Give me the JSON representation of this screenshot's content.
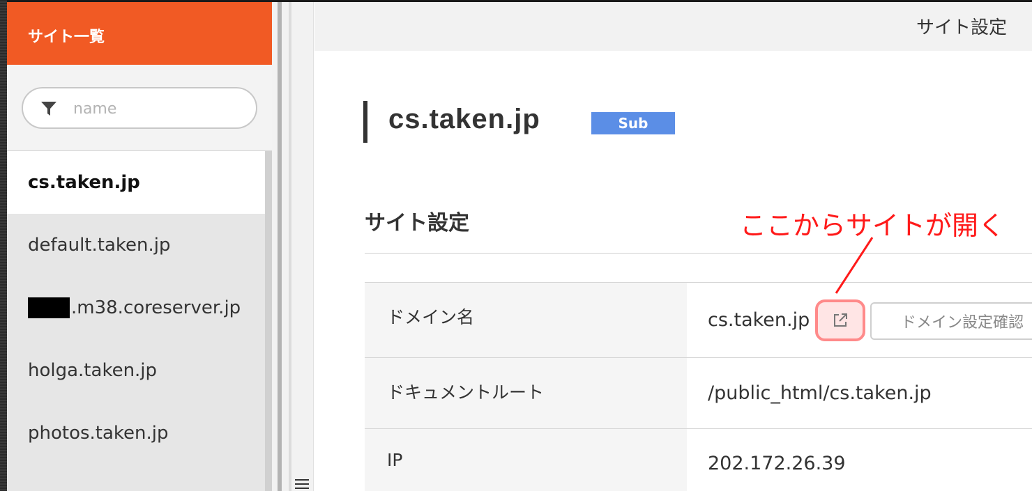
{
  "sidebar": {
    "title": "サイト一覧",
    "search_placeholder": "name",
    "sites": [
      {
        "prefix_redacted": false,
        "label": "cs.taken.jp",
        "active": true
      },
      {
        "prefix_redacted": false,
        "label": "default.taken.jp",
        "active": false
      },
      {
        "prefix_redacted": true,
        "label": ".m38.coreserver.jp",
        "active": false
      },
      {
        "prefix_redacted": false,
        "label": "holga.taken.jp",
        "active": false
      },
      {
        "prefix_redacted": false,
        "label": "photos.taken.jp",
        "active": false
      }
    ]
  },
  "topbar": {
    "title": "サイト設定"
  },
  "page": {
    "site_name": "cs.taken.jp",
    "badge": "Sub",
    "section_title": "サイト設定",
    "annotation": "ここからサイトが開く",
    "annotation_color": "#ff1a1a"
  },
  "settings": {
    "domain_label": "ドメイン名",
    "domain_value": "cs.taken.jp",
    "domain_check_button": "ドメイン設定確認",
    "docroot_label": "ドキュメントルート",
    "docroot_value": "/public_html/cs.taken.jp",
    "ip_label": "IP",
    "ip_value": "202.172.26.39"
  },
  "colors": {
    "brand": "#f15a24",
    "badge": "#5b8ee6"
  },
  "icons": {
    "search": "filter-icon",
    "external": "external-link-icon",
    "menu": "hamburger-icon"
  }
}
